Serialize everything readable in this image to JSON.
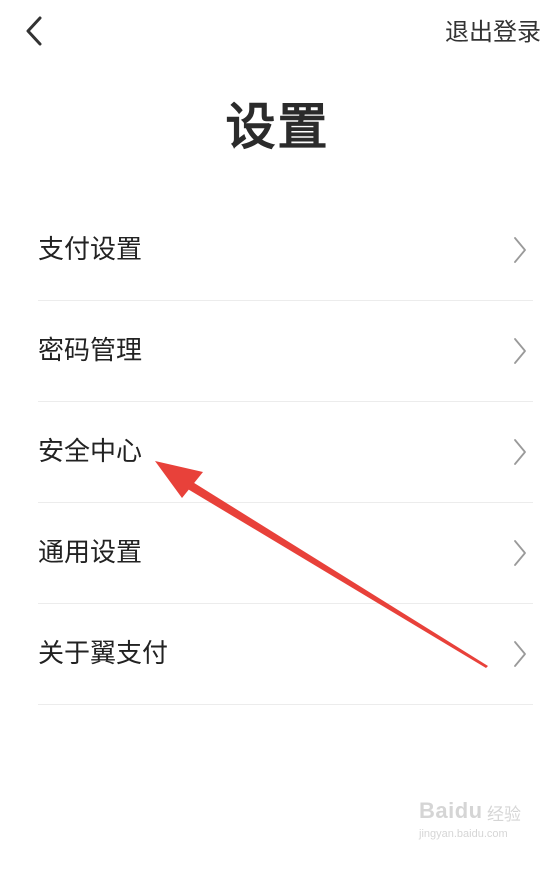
{
  "header": {
    "logout_label": "退出登录"
  },
  "page": {
    "title": "设置"
  },
  "menu": {
    "items": [
      {
        "label": "支付设置"
      },
      {
        "label": "密码管理"
      },
      {
        "label": "安全中心"
      },
      {
        "label": "通用设置"
      },
      {
        "label": "关于翼支付"
      }
    ]
  },
  "annotation": {
    "arrow_color": "#e8413a"
  },
  "watermark": {
    "brand": "Baidu",
    "sub": "经验",
    "url": "jingyan.baidu.com"
  },
  "icons": {
    "back": "back-arrow-icon",
    "chevron": "chevron-right-icon"
  }
}
